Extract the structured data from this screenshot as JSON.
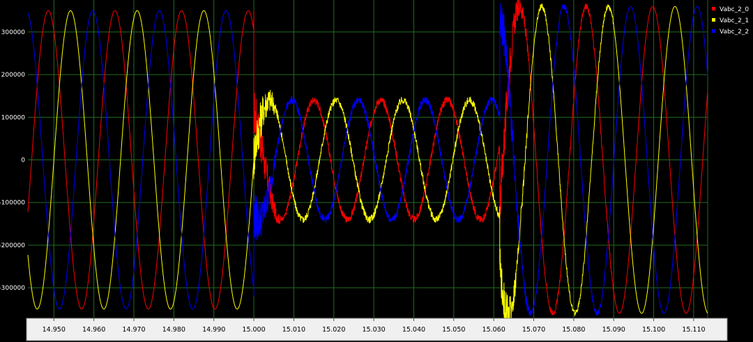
{
  "chart_data": {
    "type": "line",
    "xlabel": "",
    "ylabel": "",
    "xlim": [
      14.9435,
      15.1135
    ],
    "ylim": [
      -370000,
      375000
    ],
    "x_ticks": [
      "14.950",
      "14.960",
      "14.970",
      "14.980",
      "14.990",
      "15.000",
      "15.010",
      "15.020",
      "15.030",
      "15.040",
      "15.050",
      "15.060",
      "15.070",
      "15.080",
      "15.090",
      "15.100",
      "15.110"
    ],
    "y_ticks": [
      "300000",
      "200000",
      "100000",
      "0",
      "-100000",
      "-200000",
      "-300000"
    ],
    "y_tick_values": [
      300000,
      200000,
      100000,
      0,
      -100000,
      -200000,
      -300000
    ],
    "x_tick_values": [
      14.95,
      14.96,
      14.97,
      14.98,
      14.99,
      15.0,
      15.01,
      15.02,
      15.03,
      15.04,
      15.05,
      15.06,
      15.07,
      15.08,
      15.09,
      15.1,
      15.11
    ],
    "grid": true,
    "legend_position": "top-right",
    "frequency_hz": 60,
    "series": [
      {
        "name": "Vabc_2_0",
        "color": "#ff0000",
        "segments": [
          {
            "t": [
              14.9435,
              15.0
            ],
            "amplitude": 350000,
            "phase_deg": 120
          },
          {
            "t": [
              15.0,
              15.0615
            ],
            "amplitude": 140000,
            "phase_deg": 125
          },
          {
            "t": [
              15.0615,
              15.1135
            ],
            "amplitude": 360000,
            "phase_deg": 95
          }
        ]
      },
      {
        "name": "Vabc_2_1",
        "color": "#ffff00",
        "segments": [
          {
            "t": [
              14.9435,
              15.0
            ],
            "amplitude": 350000,
            "phase_deg": 0
          },
          {
            "t": [
              15.0,
              15.0615
            ],
            "amplitude": 140000,
            "phase_deg": 5
          },
          {
            "t": [
              15.0615,
              15.1135
            ],
            "amplitude": 360000,
            "phase_deg": -25
          }
        ]
      },
      {
        "name": "Vabc_2_2",
        "color": "#0000ff",
        "segments": [
          {
            "t": [
              14.9435,
              15.0
            ],
            "amplitude": 350000,
            "phase_deg": -120
          },
          {
            "t": [
              15.0,
              15.0615
            ],
            "amplitude": 140000,
            "phase_deg": -115
          },
          {
            "t": [
              15.0615,
              15.1135
            ],
            "amplitude": 360000,
            "phase_deg": -145
          }
        ]
      }
    ]
  },
  "colors": {
    "background": "#000000",
    "grid": "#1f6e1f",
    "axis_strip": "#f0f0f0"
  }
}
